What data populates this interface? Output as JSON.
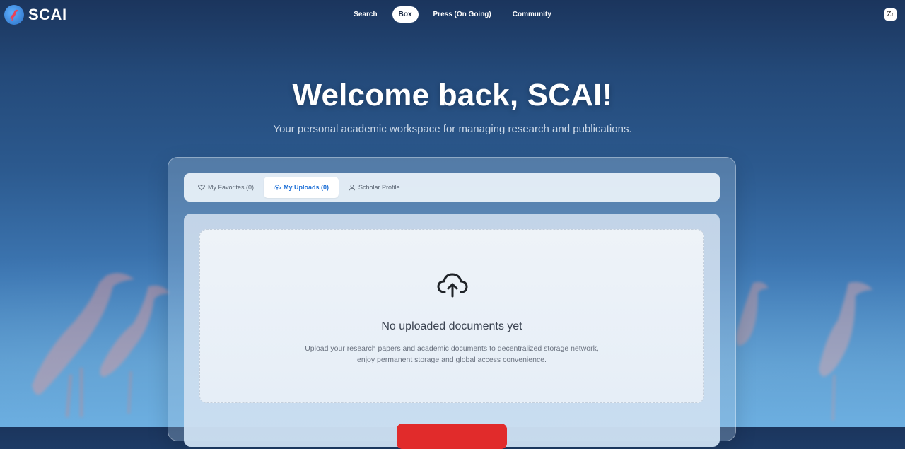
{
  "brand": {
    "name": "SCAI"
  },
  "nav": {
    "items": [
      {
        "label": "Search",
        "active": false
      },
      {
        "label": "Box",
        "active": true
      },
      {
        "label": "Press (On Going)",
        "active": false
      },
      {
        "label": "Community",
        "active": false
      }
    ]
  },
  "user_badge": {
    "text": "Zr"
  },
  "hero": {
    "title": "Welcome back, SCAI!",
    "subtitle": "Your personal academic workspace for managing research and publications."
  },
  "tabs": [
    {
      "label": "My Favorites (0)",
      "icon": "heart-icon",
      "active": false
    },
    {
      "label": "My Uploads (0)",
      "icon": "cloud-upload-icon",
      "active": true
    },
    {
      "label": "Scholar Profile",
      "icon": "user-icon",
      "active": false
    }
  ],
  "empty_state": {
    "icon": "cloud-upload-icon",
    "title": "No uploaded documents yet",
    "description": "Upload your research papers and academic documents to decentralized storage network,\nenjoy permanent storage and global access convenience."
  },
  "colors": {
    "accent": "#1d6fd6",
    "primary_button": "#e12b2b",
    "background_top": "#1b355d",
    "background_bottom": "#6aaee2"
  }
}
